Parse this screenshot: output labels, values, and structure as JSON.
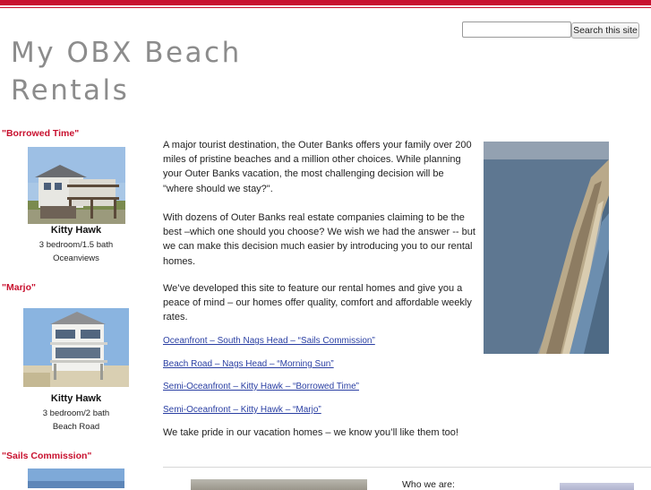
{
  "search": {
    "placeholder": "",
    "value": "",
    "button_label": "Search this site"
  },
  "site": {
    "title": "My OBX Beach Rentals",
    "accent_color": "#c8102e",
    "link_color": "#2a3fa3"
  },
  "sidebar": {
    "properties": [
      {
        "name": "\"Borrowed Time\"",
        "town": "Kitty Hawk",
        "bedrooms": "3 bedroom/1.5 bath",
        "view": "Oceanviews"
      },
      {
        "name": "\"Marjo\"",
        "town": "Kitty Hawk",
        "bedrooms": "3 bedroom/2 bath",
        "view": "Beach Road"
      },
      {
        "name": "\"Sails Commission\""
      }
    ]
  },
  "main": {
    "intro1": "A major tourist destination, the Outer Banks offers your family over 200 miles of pristine beaches and a million other choices. While planning your Outer Banks vacation, the most challenging decision will be \"where should we stay?\".",
    "intro2": "With dozens of Outer Banks real estate companies claiming to be the best –which one should you choose? We wish we had the answer -- but we can make this decision much easier by introducing you to our rental homes.",
    "intro3": "We’ve developed this site to feature our rental homes and give you a peace of mind – our homes offer quality, comfort and affordable weekly rates.",
    "links": [
      "Oceanfront – South Nags Head – “Sails Commission”",
      "Beach Road – Nags Head – “Morning Sun”",
      "Semi-Oceanfront – Kitty Hawk – “Borrowed Time”",
      "Semi-Oceanfront – Kitty Hawk – “Marjo”"
    ],
    "closing": "We take pride in our vacation homes – we know you’ll like them too!"
  },
  "bottom": {
    "who_label": "Who we are:"
  }
}
